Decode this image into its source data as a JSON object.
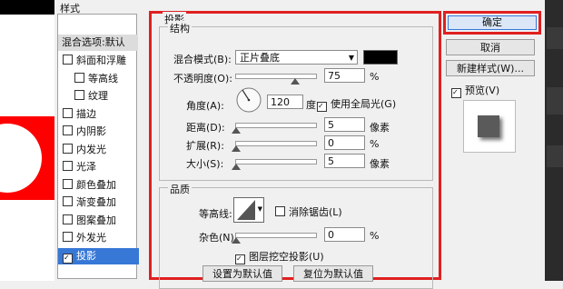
{
  "styles_panel": {
    "title": "样式",
    "header_item": "混合选项:默认",
    "items": [
      {
        "label": "斜面和浮雕",
        "checked": false,
        "indent": false
      },
      {
        "label": "等高线",
        "checked": false,
        "indent": true
      },
      {
        "label": "纹理",
        "checked": false,
        "indent": true
      },
      {
        "label": "描边",
        "checked": false,
        "indent": false
      },
      {
        "label": "内阴影",
        "checked": false,
        "indent": false
      },
      {
        "label": "内发光",
        "checked": false,
        "indent": false
      },
      {
        "label": "光泽",
        "checked": false,
        "indent": false
      },
      {
        "label": "颜色叠加",
        "checked": false,
        "indent": false
      },
      {
        "label": "渐变叠加",
        "checked": false,
        "indent": false
      },
      {
        "label": "图案叠加",
        "checked": false,
        "indent": false
      },
      {
        "label": "外发光",
        "checked": false,
        "indent": false
      },
      {
        "label": "投影",
        "checked": true,
        "indent": false,
        "selected": true
      }
    ]
  },
  "shadow": {
    "section_title": "投影",
    "structure_title": "结构",
    "blend_mode_label": "混合模式(B):",
    "blend_mode_value": "正片叠底",
    "opacity_label": "不透明度(O):",
    "opacity_value": "75",
    "opacity_unit": "%",
    "opacity_level": 0.75,
    "angle_label": "角度(A):",
    "angle_value": "120",
    "angle_unit": "度",
    "global_light_label": "使用全局光(G)",
    "global_light_checked": true,
    "distance_label": "距离(D):",
    "distance_value": "5",
    "distance_unit": "像素",
    "spread_label": "扩展(R):",
    "spread_value": "0",
    "spread_unit": "%",
    "size_label": "大小(S):",
    "size_value": "5",
    "size_unit": "像素",
    "quality_title": "品质",
    "contour_label": "等高线:",
    "antialias_label": "消除锯齿(L)",
    "noise_label": "杂色(N):",
    "noise_value": "0",
    "noise_unit": "%",
    "knockout_label": "图层挖空投影(U)",
    "set_default_label": "设置为默认值",
    "reset_default_label": "复位为默认值",
    "shadow_color": "#000000"
  },
  "actions": {
    "ok_label": "确定",
    "cancel_label": "取消",
    "new_style_label": "新建样式(W)...",
    "preview_label": "预览(V)",
    "preview_checked": true
  },
  "colors": {
    "highlight_border": "#e02020",
    "selection": "#3778d6"
  }
}
